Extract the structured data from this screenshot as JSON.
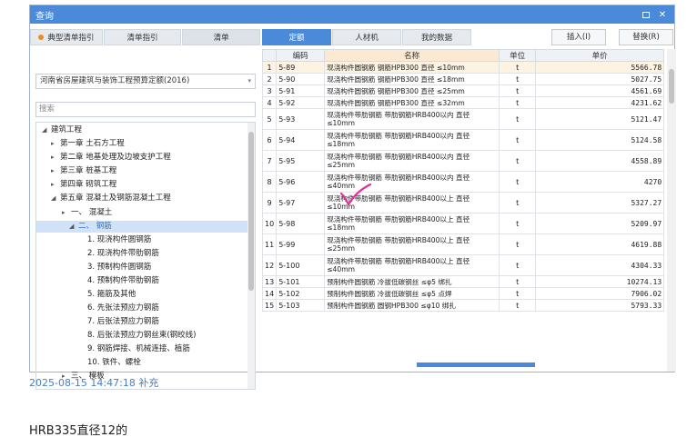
{
  "window": {
    "title": "查询"
  },
  "left_tabs": [
    {
      "label": "典型清单指引",
      "active": false,
      "has_dot": true
    },
    {
      "label": "清单指引",
      "active": false,
      "has_dot": false
    },
    {
      "label": "清单",
      "active": true,
      "has_dot": false
    }
  ],
  "quota_select": {
    "value": "河南省房屋建筑与装饰工程预算定额(2016)"
  },
  "search": {
    "placeholder": "搜索"
  },
  "tree": [
    {
      "label": "建筑工程",
      "caret": "◢"
    },
    {
      "label": "第一章 土石方工程",
      "caret": "▸"
    },
    {
      "label": "第二章 地基处理及边坡支护工程",
      "caret": "▸"
    },
    {
      "label": "第三章 桩基工程",
      "caret": "▸"
    },
    {
      "label": "第四章 砌筑工程",
      "caret": "▸"
    },
    {
      "label": "第五章 混凝土及钢筋混凝土工程",
      "caret": "◢"
    },
    {
      "label": "一、 混凝土",
      "caret": "▸"
    },
    {
      "label": "二、 钢筋",
      "caret": "◢",
      "selected": true
    },
    {
      "label": "1. 现浇构件圆钢筋",
      "caret": ""
    },
    {
      "label": "2. 现浇构件带肋钢筋",
      "caret": ""
    },
    {
      "label": "3. 预制构件圆钢筋",
      "caret": ""
    },
    {
      "label": "4. 预制构件带肋钢筋",
      "caret": ""
    },
    {
      "label": "5. 箍筋及其他",
      "caret": ""
    },
    {
      "label": "6. 先张法预应力钢筋",
      "caret": ""
    },
    {
      "label": "7. 后张法预应力钢筋",
      "caret": ""
    },
    {
      "label": "8. 后张法预应力钢丝束(钢绞线)",
      "caret": ""
    },
    {
      "label": "9. 钢筋焊接、机械连接、植筋",
      "caret": ""
    },
    {
      "label": "10. 铁件、螺栓",
      "caret": ""
    },
    {
      "label": "三、 模板",
      "caret": "▸"
    }
  ],
  "right_tabs": [
    {
      "label": "定额",
      "active": true
    },
    {
      "label": "人材机",
      "active": false
    },
    {
      "label": "我的数据",
      "active": false
    }
  ],
  "buttons": {
    "insert": "插入(I)",
    "replace": "替换(R)"
  },
  "table": {
    "headers": [
      "编码",
      "名称",
      "单位",
      "单价"
    ],
    "rows": [
      [
        "1",
        "5-89",
        "现浇构件圆钢筋 钢筋HPB300 直径 ≤10mm",
        "t",
        "5566.78"
      ],
      [
        "2",
        "5-90",
        "现浇构件圆钢筋 钢筋HPB300 直径 ≤18mm",
        "t",
        "5027.75"
      ],
      [
        "3",
        "5-91",
        "现浇构件圆钢筋 钢筋HPB300 直径 ≤25mm",
        "t",
        "4561.69"
      ],
      [
        "4",
        "5-92",
        "现浇构件圆钢筋 钢筋HPB300 直径 ≤32mm",
        "t",
        "4231.62"
      ],
      [
        "5",
        "5-93",
        "现浇构件带肋钢筋 带肋钢筋HRB400以内 直径 ≤10mm",
        "t",
        "5121.47"
      ],
      [
        "6",
        "5-94",
        "现浇构件带肋钢筋 带肋钢筋HRB400以内 直径 ≤18mm",
        "t",
        "5124.58"
      ],
      [
        "7",
        "5-95",
        "现浇构件带肋钢筋 带肋钢筋HRB400以内 直径 ≤25mm",
        "t",
        "4558.89"
      ],
      [
        "8",
        "5-96",
        "现浇构件带肋钢筋 带肋钢筋HRB400以内 直径 ≤40mm",
        "t",
        "4270"
      ],
      [
        "9",
        "5-97",
        "现浇构件带肋钢筋 带肋钢筋HRB400以上 直径 ≤10mm",
        "t",
        "5327.27"
      ],
      [
        "10",
        "5-98",
        "现浇构件带肋钢筋 带肋钢筋HRB400以上 直径 ≤18mm",
        "t",
        "5209.97"
      ],
      [
        "11",
        "5-99",
        "现浇构件带肋钢筋 带肋钢筋HRB400以上 直径 ≤25mm",
        "t",
        "4619.88"
      ],
      [
        "12",
        "5-100",
        "现浇构件带肋钢筋 带肋钢筋HRB400以上 直径 ≤40mm",
        "t",
        "4304.33"
      ],
      [
        "13",
        "5-101",
        "预制构件圆钢筋 冷拔低碳钢丝 ≤φ5 绑扎",
        "t",
        "10274.13"
      ],
      [
        "14",
        "5-102",
        "预制构件圆钢筋 冷拔低碳钢丝 ≤φ5 点焊",
        "t",
        "7906.02"
      ],
      [
        "15",
        "5-103",
        "预制构件圆钢筋 圆钢HPB300 ≤φ10 绑扎",
        "t",
        "5793.33"
      ]
    ]
  },
  "footer": {
    "timestamp": "2025-08-15 14:47:18 补充",
    "note": "HRB335直径12的"
  },
  "colors": {
    "titlebar": "#4a8ad8",
    "check_mark": "#e0309a"
  },
  "icons": {
    "minimize": "maximize-icon",
    "close": "close-icon",
    "check": "check-mark-icon"
  }
}
